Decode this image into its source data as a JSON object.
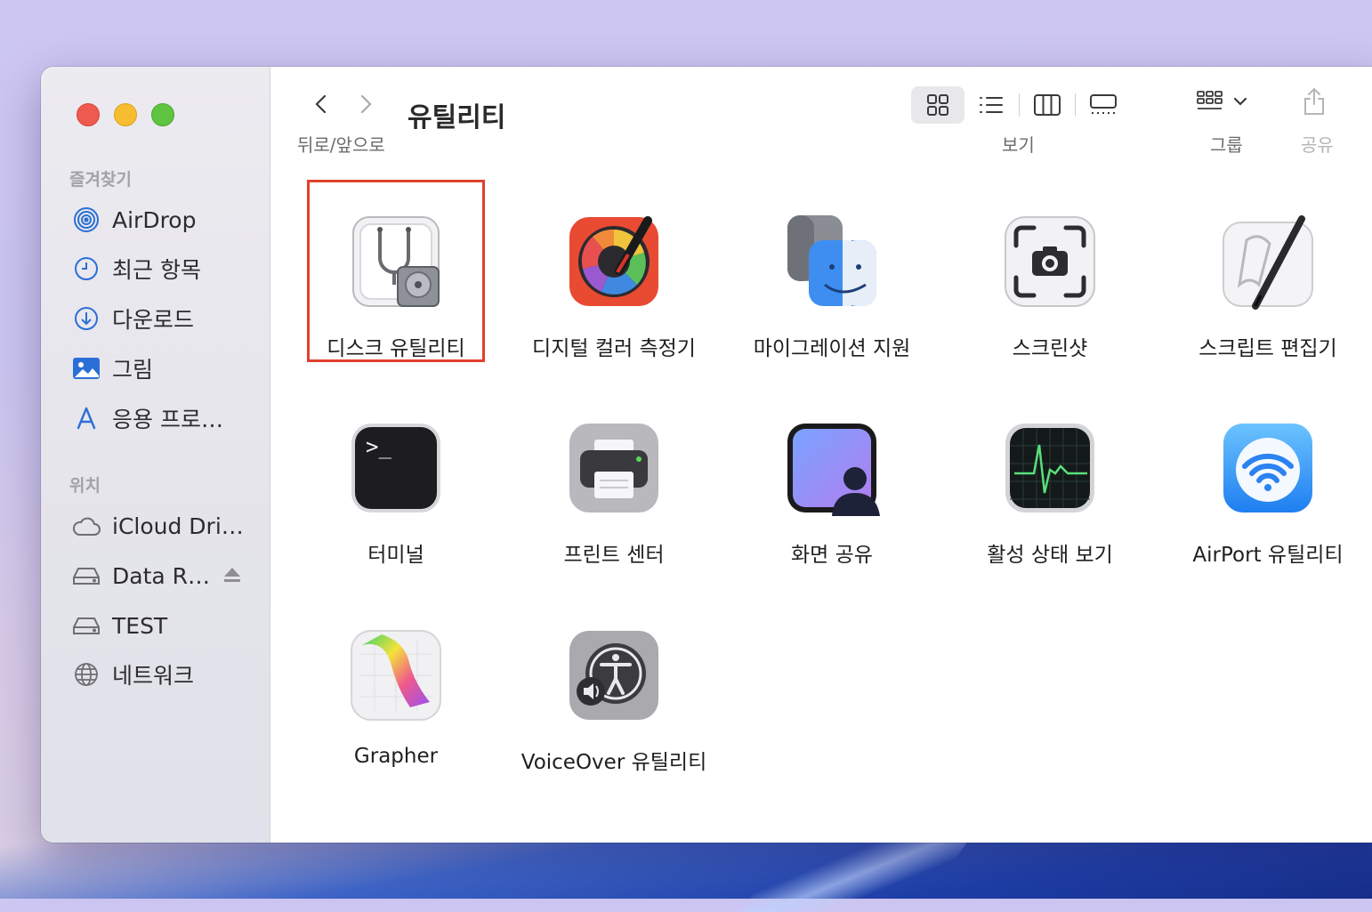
{
  "sidebar": {
    "favorites_title": "즐겨찾기",
    "favorites": [
      {
        "label": "AirDrop",
        "icon": "airdrop-icon"
      },
      {
        "label": "최근 항목",
        "icon": "clock-icon"
      },
      {
        "label": "다운로드",
        "icon": "download-icon"
      },
      {
        "label": "그림",
        "icon": "photo-icon"
      },
      {
        "label": "응용 프로…",
        "icon": "applications-icon"
      }
    ],
    "locations_title": "위치",
    "locations": [
      {
        "label": "iCloud Dri…",
        "icon": "cloud-icon"
      },
      {
        "label": "Data R…",
        "icon": "drive-icon"
      },
      {
        "label": "TEST",
        "icon": "drive-icon"
      },
      {
        "label": "네트워크",
        "icon": "network-icon"
      }
    ]
  },
  "toolbar": {
    "title": "유틸리티",
    "nav_label": "뒤로/앞으로",
    "view_label": "보기",
    "group_label": "그룹",
    "share_label": "공유"
  },
  "apps": [
    {
      "label": "디스크 유틸리티",
      "icon": "disk-utility-icon",
      "selected": true
    },
    {
      "label": "디지털 컬러 측정기",
      "icon": "digital-color-meter-icon"
    },
    {
      "label": "마이그레이션 지원",
      "icon": "migration-assistant-icon"
    },
    {
      "label": "스크린샷",
      "icon": "screenshot-icon"
    },
    {
      "label": "스크립트 편집기",
      "icon": "script-editor-icon"
    },
    {
      "label": "터미널",
      "icon": "terminal-icon"
    },
    {
      "label": "프린트 센터",
      "icon": "print-center-icon"
    },
    {
      "label": "화면 공유",
      "icon": "screen-sharing-icon"
    },
    {
      "label": "활성 상태 보기",
      "icon": "activity-monitor-icon"
    },
    {
      "label": "AirPort 유틸리티",
      "icon": "airport-utility-icon"
    },
    {
      "label": "Grapher",
      "icon": "grapher-icon"
    },
    {
      "label": "VoiceOver 유틸리티",
      "icon": "voiceover-utility-icon"
    }
  ],
  "colors": {
    "selection": "#e0412f",
    "sidebar_icon": "#2b6fd6"
  }
}
